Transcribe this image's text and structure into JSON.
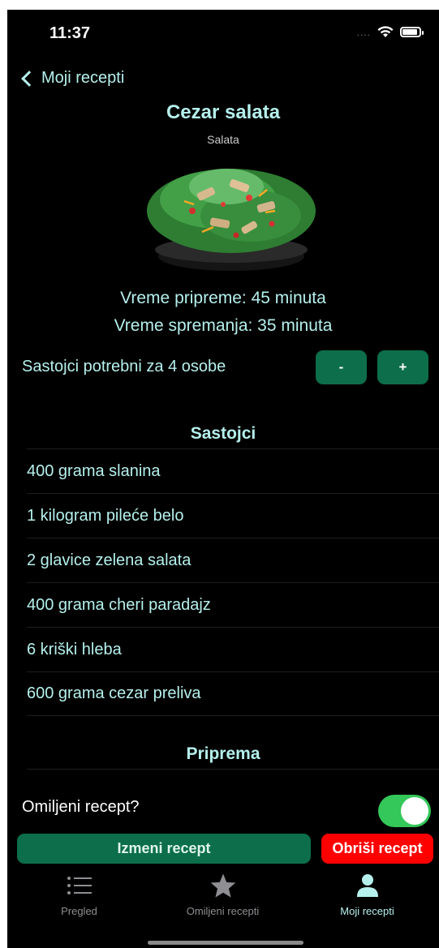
{
  "status_bar": {
    "time": "11:37",
    "signal": "....",
    "wifi_icon": "wifi-icon",
    "battery_icon": "battery-icon"
  },
  "nav": {
    "back_label": "Moji recepti"
  },
  "recipe": {
    "title": "Cezar salata",
    "category": "Salata",
    "prep_time": "Vreme pripreme: 45 minuta",
    "cook_time": "Vreme spremanja: 35 minuta"
  },
  "servings": {
    "label": "Sastojci potrebni za 4 osobe",
    "minus": "-",
    "plus": "+"
  },
  "ingredients": {
    "title": "Sastojci",
    "items": [
      "400 grama slanina",
      "1 kilogram pileće belo",
      "2 glavice zelena salata",
      "400 grama cheri paradajz",
      "6 kriški hleba",
      "600 grama cezar preliva"
    ]
  },
  "preparation": {
    "title": "Priprema"
  },
  "favorite": {
    "label": "Omiljeni recept?",
    "on": true
  },
  "actions": {
    "edit_label": "Izmeni recept",
    "delete_label": "Obriši recept"
  },
  "tabs": [
    {
      "label": "Pregled",
      "icon": "list-icon",
      "active": false
    },
    {
      "label": "Omiljeni recepti",
      "icon": "star-icon",
      "active": false
    },
    {
      "label": "Moji recepti",
      "icon": "person-icon",
      "active": true
    }
  ],
  "colors": {
    "accent": "#b5f0ec",
    "button_green": "#0c6e4a",
    "delete_red": "#ff0000",
    "toggle_green": "#34c759"
  }
}
